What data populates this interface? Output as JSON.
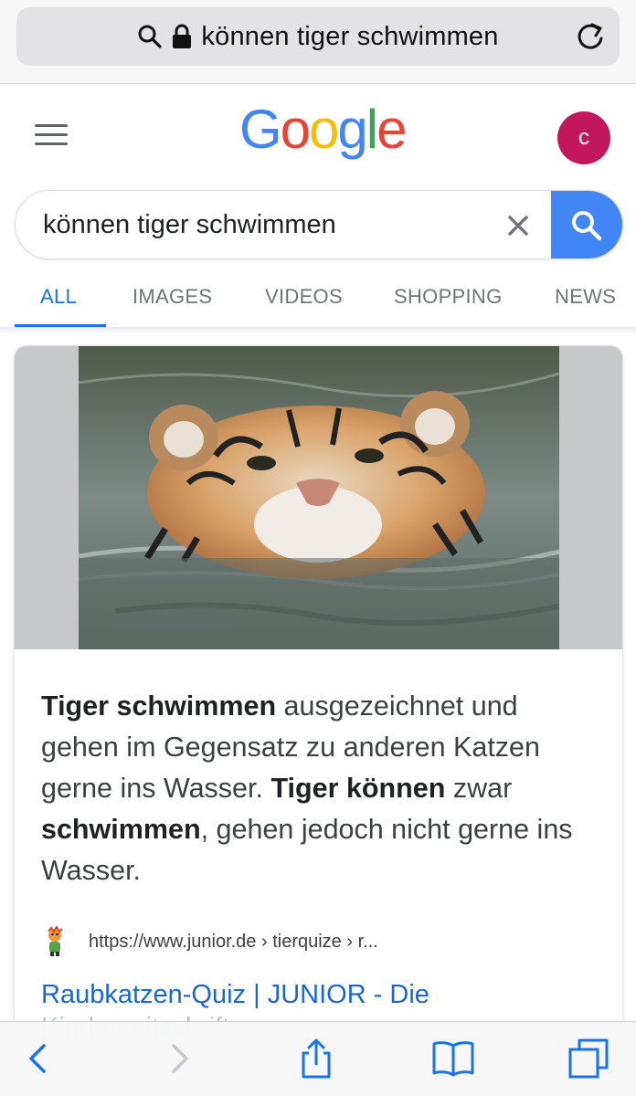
{
  "browser": {
    "address_text": "können tiger schwimmen",
    "icons": [
      "search-icon",
      "lock-icon",
      "reload-icon"
    ]
  },
  "header": {
    "logo_letters": [
      "G",
      "o",
      "o",
      "g",
      "l",
      "e"
    ],
    "logo_colors": [
      "#4285f4",
      "#ea4335",
      "#fbbc05",
      "#4285f4",
      "#34a853",
      "#ea4335"
    ],
    "avatar_letter": "c",
    "avatar_color": "#c2185b"
  },
  "search": {
    "query": "können tiger schwimmen",
    "button_color": "#4285f4"
  },
  "tabs": [
    {
      "label": "ALL",
      "active": true
    },
    {
      "label": "IMAGES",
      "active": false
    },
    {
      "label": "VIDEOS",
      "active": false
    },
    {
      "label": "SHOPPING",
      "active": false
    },
    {
      "label": "NEWS",
      "active": false
    }
  ],
  "result": {
    "image_subject": "tiger swimming in water",
    "snippet": [
      {
        "text": "Tiger schwimmen",
        "bold": true
      },
      {
        "text": " ausgezeichnet und gehen im Gegensatz zu anderen Katzen gerne ins Wasser. ",
        "bold": false
      },
      {
        "text": "Tiger können",
        "bold": true
      },
      {
        "text": " zwar ",
        "bold": false
      },
      {
        "text": "schwimmen",
        "bold": true
      },
      {
        "text": ", gehen jedoch nicht gerne ins Wasser.",
        "bold": false
      }
    ],
    "source_url": "https://www.junior.de › tierquize › r...",
    "title": "Raubkatzen-Quiz | JUNIOR - Die",
    "title_cont": "Kinderzeitschrift"
  },
  "toolbar": {
    "icons": [
      "back-icon",
      "forward-icon",
      "share-icon",
      "bookmarks-icon",
      "tabs-icon"
    ]
  }
}
